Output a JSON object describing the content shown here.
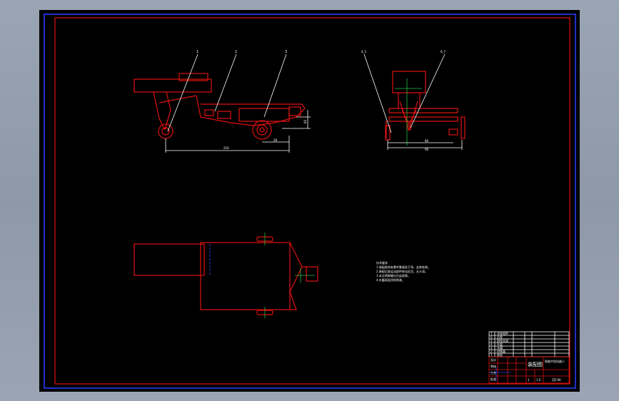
{
  "drawing": {
    "leaders": {
      "side": [
        "1",
        "2",
        "3"
      ],
      "front": [
        "4_5",
        "6_7"
      ]
    },
    "dimensions": {
      "side_length": "220",
      "side_offset": "28",
      "side_height": "60",
      "front_a": "80",
      "front_b": "90"
    },
    "notes": [
      "技术要求",
      "1.装配前所有零件需清洗干净，去除毛刺。",
      "2.装配后各运动部件转动灵活，无卡滞。",
      "3.未注明焊缝均为连续焊。",
      "4.外露表面涂防锈漆。"
    ],
    "title_block": {
      "title": "装配图",
      "project": "智能中型机器人",
      "drawing_no": "ZJT-00",
      "scale": "1:5",
      "sheet": "1",
      "sheets": "1",
      "parts": [
        {
          "no": "7",
          "name": "车轮组件"
        },
        {
          "no": "6",
          "name": "后轮"
        },
        {
          "no": "5",
          "name": "前轮支架"
        },
        {
          "no": "4",
          "name": "车架"
        },
        {
          "no": "3",
          "name": "车厢"
        },
        {
          "no": "2",
          "name": "控制盒"
        },
        {
          "no": "1",
          "name": "前轮"
        }
      ],
      "sign_labels": [
        "设计",
        "审核",
        "工艺",
        "批准"
      ]
    }
  }
}
